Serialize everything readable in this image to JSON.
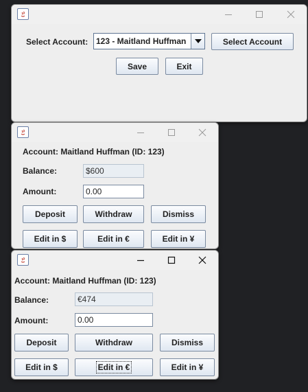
{
  "main_window": {
    "select_account_label": "Select Account:",
    "account_combo_value": "123 - Maitland Huffman",
    "select_account_button": "Select Account",
    "save_button": "Save",
    "exit_button": "Exit"
  },
  "account_window_usd": {
    "account_info": "Account: Maitland Huffman (ID: 123)",
    "balance_label": "Balance:",
    "balance_value": "$600",
    "amount_label": "Amount:",
    "amount_value": "0.00",
    "deposit_button": "Deposit",
    "withdraw_button": "Withdraw",
    "dismiss_button": "Dismiss",
    "edit_usd_button": "Edit in $",
    "edit_eur_button": "Edit in €",
    "edit_jpy_button": "Edit in ¥"
  },
  "account_window_eur": {
    "account_info": "Account: Maitland Huffman (ID: 123)",
    "balance_label": "Balance:",
    "balance_value": "€474",
    "amount_label": "Amount:",
    "amount_value": "0.00",
    "deposit_button": "Deposit",
    "withdraw_button": "Withdraw",
    "dismiss_button": "Dismiss",
    "edit_usd_button": "Edit in $",
    "edit_eur_button": "Edit in €",
    "edit_jpy_button": "Edit in ¥"
  }
}
